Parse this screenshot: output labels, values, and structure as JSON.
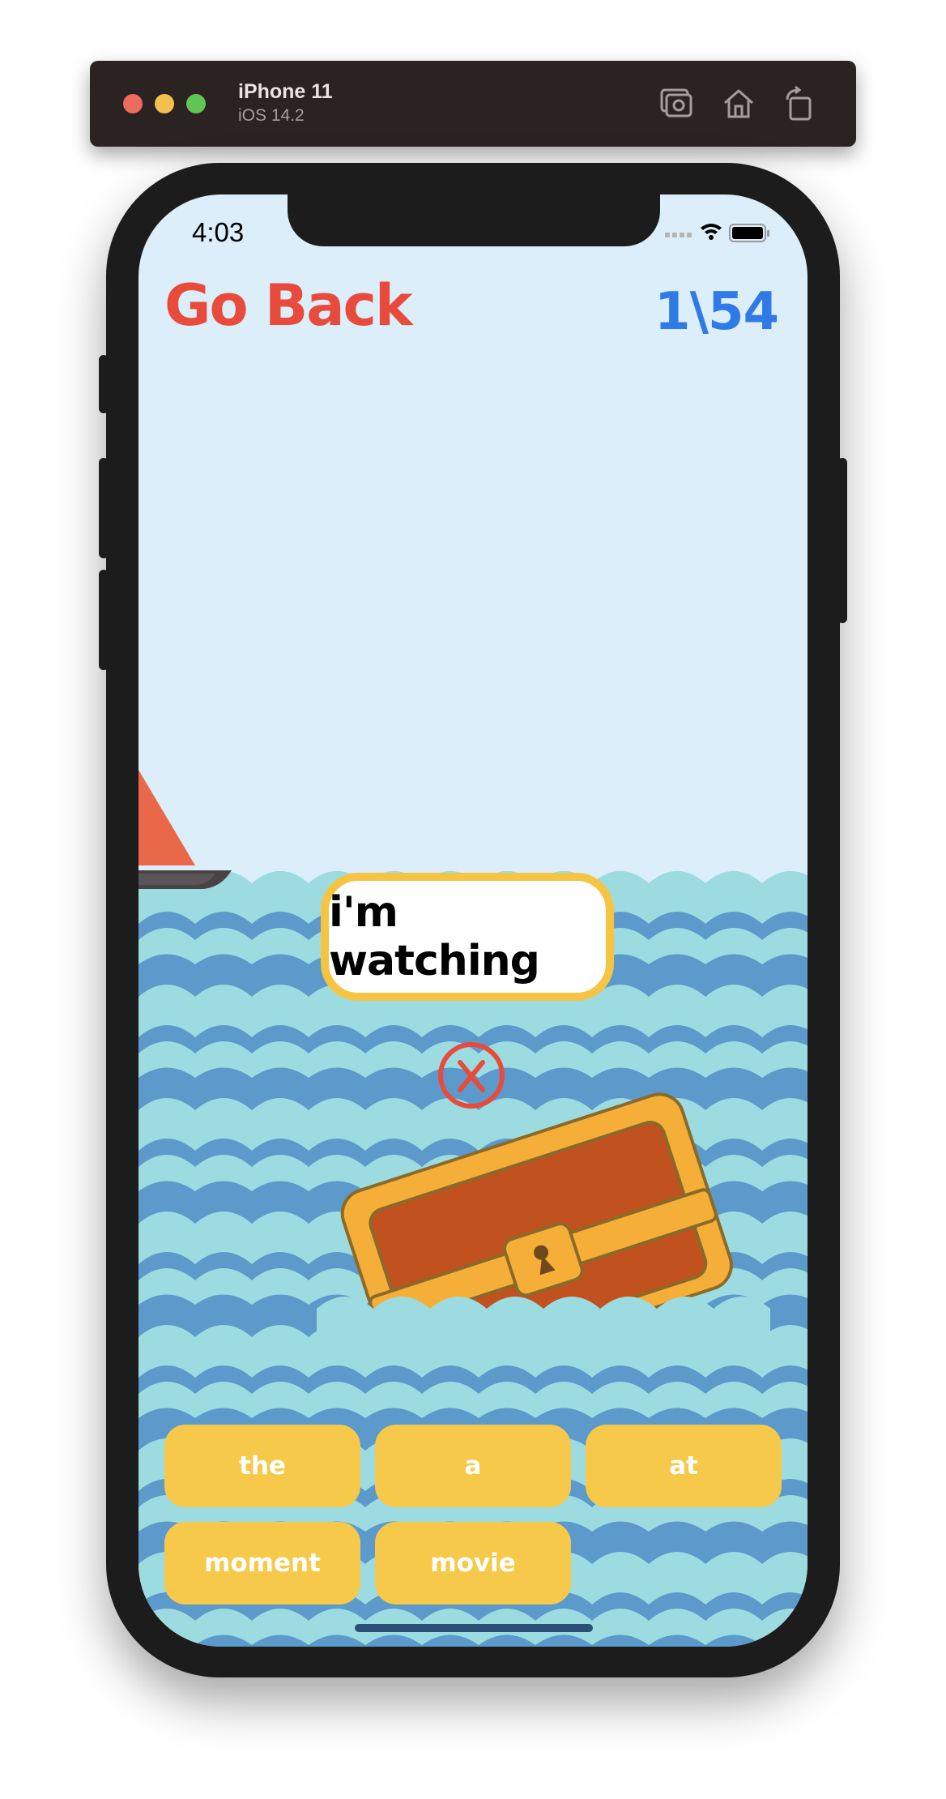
{
  "simulator": {
    "device_name": "iPhone 11",
    "os_version": "iOS 14.2",
    "toolbar_icons": [
      "screenshot-icon",
      "home-icon",
      "rotate-icon"
    ]
  },
  "status_bar": {
    "time": "4:03",
    "icons": [
      "signal-icon",
      "wifi-icon",
      "battery-icon"
    ]
  },
  "game": {
    "back_label": "Go Back",
    "progress": "1\\54",
    "sentence": "i'm watching",
    "word_buttons": [
      "the",
      "a",
      "at",
      "moment",
      "movie"
    ]
  },
  "colors": {
    "sky": "#dbeefa",
    "wave_light": "#9cdce0",
    "wave_dark": "#5b9acb",
    "accent_yellow": "#f6c94a",
    "back_red": "#e84b3c",
    "progress_blue": "#2f7ae6"
  }
}
